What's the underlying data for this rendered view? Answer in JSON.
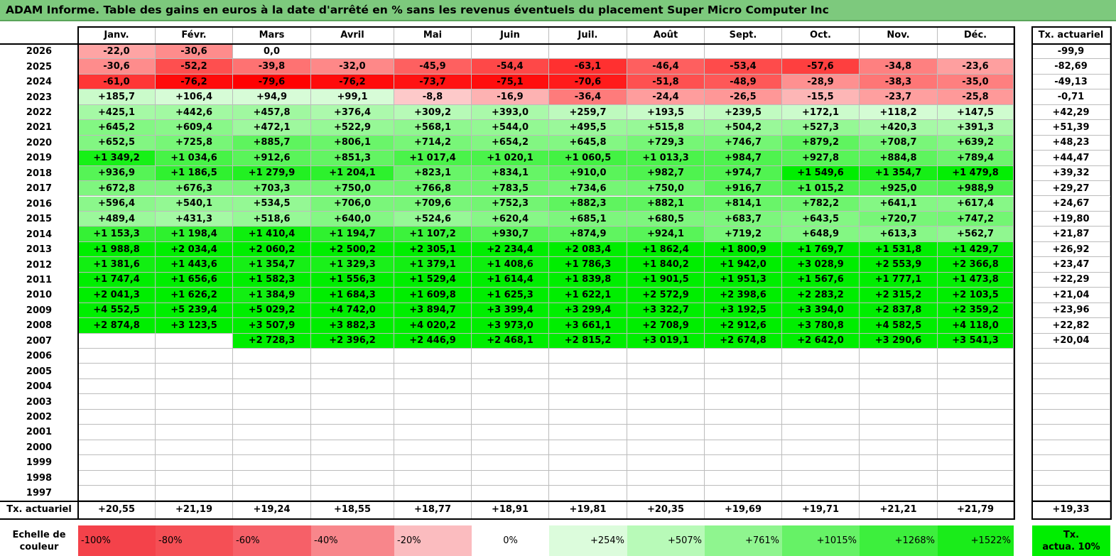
{
  "title": "ADAM Informe. Table des gains en euros à la date d'arrêté en % sans les revenus éventuels du placement Super Micro Computer Inc",
  "colors": {
    "title_bg": "#7dc97d",
    "neg_strong": "#ff0000",
    "neg_light": "#fde2e2",
    "pos_light": "#e6fde6",
    "pos_strong": "#00ee00",
    "actuarial_highlight": "#00ee00"
  },
  "chart_data": {
    "type": "heatmap",
    "months": [
      "Janv.",
      "Févr.",
      "Mars",
      "Avril",
      "Mai",
      "Juin",
      "Juil.",
      "Août",
      "Sept.",
      "Oct.",
      "Nov.",
      "Déc."
    ],
    "rate_header": "Tx. actuariel",
    "rows": [
      {
        "year": "2026",
        "values": [
          "-22,0",
          "-30,6",
          "0,0",
          "",
          "",
          "",
          "",
          "",
          "",
          "",
          "",
          ""
        ],
        "rate": "-99,9"
      },
      {
        "year": "2025",
        "values": [
          "-30,6",
          "-52,2",
          "-39,8",
          "-32,0",
          "-45,9",
          "-54,4",
          "-63,1",
          "-46,4",
          "-53,4",
          "-57,6",
          "-34,8",
          "-23,6"
        ],
        "rate": "-82,69"
      },
      {
        "year": "2024",
        "values": [
          "-61,0",
          "-76,2",
          "-79,6",
          "-76,2",
          "-73,7",
          "-75,1",
          "-70,6",
          "-51,8",
          "-48,9",
          "-28,9",
          "-38,3",
          "-35,0"
        ],
        "rate": "-49,13"
      },
      {
        "year": "2023",
        "values": [
          "+185,7",
          "+106,4",
          "+94,9",
          "+99,1",
          "-8,8",
          "-16,9",
          "-36,4",
          "-24,4",
          "-26,5",
          "-15,5",
          "-23,7",
          "-25,8"
        ],
        "rate": "-0,71"
      },
      {
        "year": "2022",
        "values": [
          "+425,1",
          "+442,6",
          "+457,8",
          "+376,4",
          "+309,2",
          "+393,0",
          "+259,7",
          "+193,5",
          "+239,5",
          "+172,1",
          "+118,2",
          "+147,5"
        ],
        "rate": "+42,29"
      },
      {
        "year": "2021",
        "values": [
          "+645,2",
          "+609,4",
          "+472,1",
          "+522,9",
          "+568,1",
          "+544,0",
          "+495,5",
          "+515,8",
          "+504,2",
          "+527,3",
          "+420,3",
          "+391,3"
        ],
        "rate": "+51,39"
      },
      {
        "year": "2020",
        "values": [
          "+652,5",
          "+725,8",
          "+885,7",
          "+806,1",
          "+714,2",
          "+654,2",
          "+645,8",
          "+729,3",
          "+746,7",
          "+879,2",
          "+708,7",
          "+639,2"
        ],
        "rate": "+48,23"
      },
      {
        "year": "2019",
        "values": [
          "+1 349,2",
          "+1 034,6",
          "+912,6",
          "+851,3",
          "+1 017,4",
          "+1 020,1",
          "+1 060,5",
          "+1 013,3",
          "+984,7",
          "+927,8",
          "+884,8",
          "+789,4"
        ],
        "rate": "+44,47"
      },
      {
        "year": "2018",
        "values": [
          "+936,9",
          "+1 186,5",
          "+1 279,9",
          "+1 204,1",
          "+823,1",
          "+834,1",
          "+910,0",
          "+982,7",
          "+974,7",
          "+1 549,6",
          "+1 354,7",
          "+1 479,8"
        ],
        "rate": "+39,32"
      },
      {
        "year": "2017",
        "values": [
          "+672,8",
          "+676,3",
          "+703,3",
          "+750,0",
          "+766,8",
          "+783,5",
          "+734,6",
          "+750,0",
          "+916,7",
          "+1 015,2",
          "+925,0",
          "+988,9"
        ],
        "rate": "+29,27"
      },
      {
        "year": "2016",
        "values": [
          "+596,4",
          "+540,1",
          "+534,5",
          "+706,0",
          "+709,6",
          "+752,3",
          "+882,3",
          "+882,1",
          "+814,1",
          "+782,2",
          "+641,1",
          "+617,4"
        ],
        "rate": "+24,67"
      },
      {
        "year": "2015",
        "values": [
          "+489,4",
          "+431,3",
          "+518,6",
          "+640,0",
          "+524,6",
          "+620,4",
          "+685,1",
          "+680,5",
          "+683,7",
          "+643,5",
          "+720,7",
          "+747,2"
        ],
        "rate": "+19,80"
      },
      {
        "year": "2014",
        "values": [
          "+1 153,3",
          "+1 198,4",
          "+1 410,4",
          "+1 194,7",
          "+1 107,2",
          "+930,7",
          "+874,9",
          "+924,1",
          "+719,2",
          "+648,9",
          "+613,3",
          "+562,7"
        ],
        "rate": "+21,87"
      },
      {
        "year": "2013",
        "values": [
          "+1 988,8",
          "+2 034,4",
          "+2 060,2",
          "+2 500,2",
          "+2 305,1",
          "+2 234,4",
          "+2 083,4",
          "+1 862,4",
          "+1 800,9",
          "+1 769,7",
          "+1 531,8",
          "+1 429,7"
        ],
        "rate": "+26,92"
      },
      {
        "year": "2012",
        "values": [
          "+1 381,6",
          "+1 443,6",
          "+1 354,7",
          "+1 329,3",
          "+1 379,1",
          "+1 408,6",
          "+1 786,3",
          "+1 840,2",
          "+1 942,0",
          "+3 028,9",
          "+2 553,9",
          "+2 366,8"
        ],
        "rate": "+23,47"
      },
      {
        "year": "2011",
        "values": [
          "+1 747,4",
          "+1 656,6",
          "+1 582,3",
          "+1 556,3",
          "+1 529,4",
          "+1 614,4",
          "+1 839,8",
          "+1 901,5",
          "+1 951,3",
          "+1 567,6",
          "+1 777,1",
          "+1 473,8"
        ],
        "rate": "+22,29"
      },
      {
        "year": "2010",
        "values": [
          "+2 041,3",
          "+1 626,2",
          "+1 384,9",
          "+1 684,3",
          "+1 609,8",
          "+1 625,3",
          "+1 622,1",
          "+2 572,9",
          "+2 398,6",
          "+2 283,2",
          "+2 315,2",
          "+2 103,5"
        ],
        "rate": "+21,04"
      },
      {
        "year": "2009",
        "values": [
          "+4 552,5",
          "+5 239,4",
          "+5 029,2",
          "+4 742,0",
          "+3 894,7",
          "+3 399,4",
          "+3 299,4",
          "+3 322,7",
          "+3 192,5",
          "+3 394,0",
          "+2 837,8",
          "+2 359,2"
        ],
        "rate": "+23,96"
      },
      {
        "year": "2008",
        "values": [
          "+2 874,8",
          "+3 123,5",
          "+3 507,9",
          "+3 882,3",
          "+4 020,2",
          "+3 973,0",
          "+3 661,1",
          "+2 708,9",
          "+2 912,6",
          "+3 780,8",
          "+4 582,5",
          "+4 118,0"
        ],
        "rate": "+22,82"
      },
      {
        "year": "2007",
        "values": [
          "",
          "",
          "+2 728,3",
          "+2 396,2",
          "+2 446,9",
          "+2 468,1",
          "+2 815,2",
          "+3 019,1",
          "+2 674,8",
          "+2 642,0",
          "+3 290,6",
          "+3 541,3"
        ],
        "rate": "+20,04"
      },
      {
        "year": "2006",
        "values": [
          "",
          "",
          "",
          "",
          "",
          "",
          "",
          "",
          "",
          "",
          "",
          ""
        ],
        "rate": ""
      },
      {
        "year": "2005",
        "values": [
          "",
          "",
          "",
          "",
          "",
          "",
          "",
          "",
          "",
          "",
          "",
          ""
        ],
        "rate": ""
      },
      {
        "year": "2004",
        "values": [
          "",
          "",
          "",
          "",
          "",
          "",
          "",
          "",
          "",
          "",
          "",
          ""
        ],
        "rate": ""
      },
      {
        "year": "2003",
        "values": [
          "",
          "",
          "",
          "",
          "",
          "",
          "",
          "",
          "",
          "",
          "",
          ""
        ],
        "rate": ""
      },
      {
        "year": "2002",
        "values": [
          "",
          "",
          "",
          "",
          "",
          "",
          "",
          "",
          "",
          "",
          "",
          ""
        ],
        "rate": ""
      },
      {
        "year": "2001",
        "values": [
          "",
          "",
          "",
          "",
          "",
          "",
          "",
          "",
          "",
          "",
          "",
          ""
        ],
        "rate": ""
      },
      {
        "year": "2000",
        "values": [
          "",
          "",
          "",
          "",
          "",
          "",
          "",
          "",
          "",
          "",
          "",
          ""
        ],
        "rate": ""
      },
      {
        "year": "1999",
        "values": [
          "",
          "",
          "",
          "",
          "",
          "",
          "",
          "",
          "",
          "",
          "",
          ""
        ],
        "rate": ""
      },
      {
        "year": "1998",
        "values": [
          "",
          "",
          "",
          "",
          "",
          "",
          "",
          "",
          "",
          "",
          "",
          ""
        ],
        "rate": ""
      },
      {
        "year": "1997",
        "values": [
          "",
          "",
          "",
          "",
          "",
          "",
          "",
          "",
          "",
          "",
          "",
          ""
        ],
        "rate": ""
      }
    ],
    "footer": {
      "label": "Tx. actuariel",
      "values": [
        "+20,55",
        "+21,19",
        "+19,24",
        "+18,55",
        "+18,77",
        "+18,91",
        "+19,81",
        "+20,35",
        "+19,69",
        "+19,71",
        "+21,21",
        "+21,79"
      ],
      "overall": "+19,33"
    },
    "legend": {
      "label_line1": "Echelle de",
      "label_line2": "couleur",
      "steps": [
        "-100%",
        "-80%",
        "-60%",
        "-40%",
        "-20%",
        "0%",
        "+254%",
        "+507%",
        "+761%",
        "+1015%",
        "+1268%",
        "+1522%"
      ],
      "step_colors": [
        "#f4424a",
        "#f54f55",
        "#f66068",
        "#f8868b",
        "#fbbcbf",
        "#ffffff",
        "#dcfcdc",
        "#b8fab8",
        "#8ff58f",
        "#66f266",
        "#3def3d",
        "#1aec1a"
      ],
      "tail_line1": "Tx.",
      "tail_line2": "actua. 10%"
    }
  }
}
